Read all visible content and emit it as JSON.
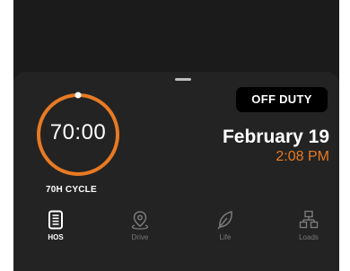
{
  "hos": {
    "cycle_time": "70:00",
    "cycle_label": "70H CYCLE",
    "cycle_remaining_fraction": 1.0,
    "ring_color": "#e87a23"
  },
  "status": {
    "label": "OFF DUTY"
  },
  "datetime": {
    "date": "February 19",
    "time": "2:08 PM",
    "time_color": "#e87a23"
  },
  "nav": {
    "items": [
      {
        "label": "HOS",
        "icon": "document-list-icon",
        "active": true
      },
      {
        "label": "Drive",
        "icon": "map-pin-icon",
        "active": false
      },
      {
        "label": "Life",
        "icon": "leaf-icon",
        "active": false
      },
      {
        "label": "Loads",
        "icon": "network-boxes-icon",
        "active": false
      }
    ]
  }
}
